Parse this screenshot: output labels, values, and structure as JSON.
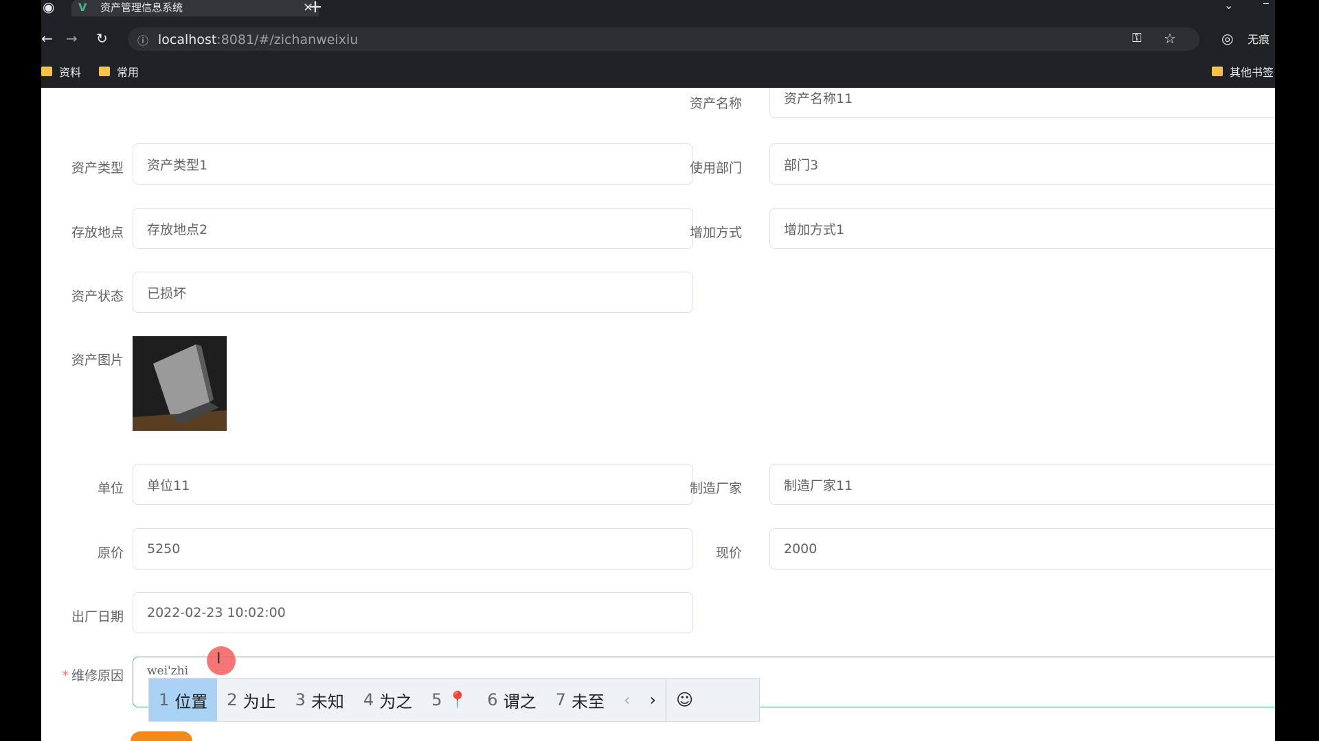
{
  "browser": {
    "tab_title": "资产管理信息系统",
    "url_host": "localhost",
    "url_path": ":8081/#/zichanweixiu",
    "profile_label": "无痕",
    "bookmarks": [
      {
        "label": "资料"
      },
      {
        "label": "常用"
      }
    ],
    "other_bookmarks": "其他书签"
  },
  "form": {
    "asset_name": {
      "label": "资产名称",
      "value": "资产名称11"
    },
    "asset_type": {
      "label": "资产类型",
      "value": "资产类型1"
    },
    "department": {
      "label": "使用部门",
      "value": "部门3"
    },
    "location": {
      "label": "存放地点",
      "value": "存放地点2"
    },
    "add_method": {
      "label": "增加方式",
      "value": "增加方式1"
    },
    "status": {
      "label": "资产状态",
      "value": "已损坏"
    },
    "photo_label": "资产图片",
    "unit": {
      "label": "单位",
      "value": "单位11"
    },
    "manufacturer": {
      "label": "制造厂家",
      "value": "制造厂家11"
    },
    "original_price": {
      "label": "原价",
      "value": "5250"
    },
    "current_price": {
      "label": "现价",
      "value": "2000"
    },
    "factory_date": {
      "label": "出厂日期",
      "value": "2022-02-23 10:02:00"
    },
    "repair_reason": {
      "label": "维修原因",
      "required_mark": "*",
      "typed": "wei'zhi"
    }
  },
  "ime": {
    "candidates": [
      {
        "num": "1",
        "text": "位置"
      },
      {
        "num": "2",
        "text": "为止"
      },
      {
        "num": "3",
        "text": "未知"
      },
      {
        "num": "4",
        "text": "为之"
      },
      {
        "num": "5",
        "text": "📍"
      },
      {
        "num": "6",
        "text": "谓之"
      },
      {
        "num": "7",
        "text": "未至"
      }
    ],
    "prev": "‹",
    "next": "›",
    "emoji": "☺"
  }
}
